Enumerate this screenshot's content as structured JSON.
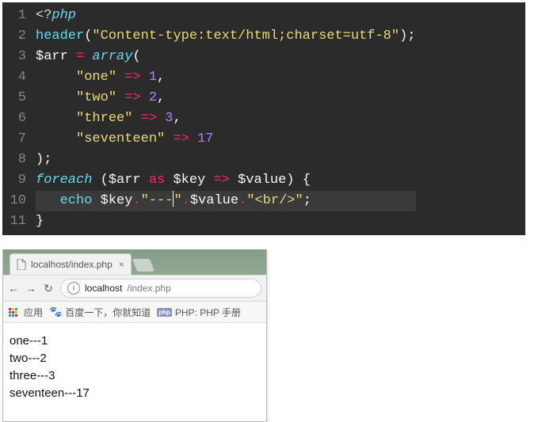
{
  "editor": {
    "lines": [
      {
        "n": 1,
        "tokens": [
          [
            "tag",
            "<?"
          ],
          [
            "kw",
            "php"
          ]
        ]
      },
      {
        "n": 2,
        "tokens": [
          [
            "fn",
            "header"
          ],
          [
            "punc",
            "("
          ],
          [
            "str",
            "\"Content-type:text/html;charset=utf-8\""
          ],
          [
            "punc",
            ")"
          ],
          [
            "punc",
            ";"
          ]
        ]
      },
      {
        "n": 3,
        "tokens": [
          [
            "var",
            "$arr "
          ],
          [
            "op",
            "="
          ],
          [
            "var",
            " "
          ],
          [
            "kw",
            "array"
          ],
          [
            "punc",
            "("
          ]
        ]
      },
      {
        "n": 4,
        "tokens": [
          [
            "var",
            "     "
          ],
          [
            "str",
            "\"one\""
          ],
          [
            "var",
            " "
          ],
          [
            "op",
            "=>"
          ],
          [
            "var",
            " "
          ],
          [
            "num",
            "1"
          ],
          [
            "punc",
            ","
          ]
        ]
      },
      {
        "n": 5,
        "tokens": [
          [
            "var",
            "     "
          ],
          [
            "str",
            "\"two\""
          ],
          [
            "var",
            " "
          ],
          [
            "op",
            "=>"
          ],
          [
            "var",
            " "
          ],
          [
            "num",
            "2"
          ],
          [
            "punc",
            ","
          ]
        ]
      },
      {
        "n": 6,
        "tokens": [
          [
            "var",
            "     "
          ],
          [
            "str",
            "\"three\""
          ],
          [
            "var",
            " "
          ],
          [
            "op",
            "=>"
          ],
          [
            "var",
            " "
          ],
          [
            "num",
            "3"
          ],
          [
            "punc",
            ","
          ]
        ]
      },
      {
        "n": 7,
        "tokens": [
          [
            "var",
            "     "
          ],
          [
            "str",
            "\"seventeen\""
          ],
          [
            "var",
            " "
          ],
          [
            "op",
            "=>"
          ],
          [
            "var",
            " "
          ],
          [
            "num",
            "17"
          ]
        ]
      },
      {
        "n": 8,
        "tokens": [
          [
            "punc",
            ")"
          ],
          [
            "punc",
            ";"
          ]
        ]
      },
      {
        "n": 9,
        "tokens": [
          [
            "kw",
            "foreach"
          ],
          [
            "var",
            " "
          ],
          [
            "punc",
            "("
          ],
          [
            "var",
            "$arr "
          ],
          [
            "op",
            "as"
          ],
          [
            "var",
            " $key "
          ],
          [
            "op",
            "=>"
          ],
          [
            "var",
            " $value"
          ],
          [
            "punc",
            ")"
          ],
          [
            "var",
            " "
          ],
          [
            "punc",
            "{"
          ]
        ]
      },
      {
        "n": 10,
        "hl": true,
        "tokens": [
          [
            "var",
            "   "
          ],
          [
            "fn",
            "echo"
          ],
          [
            "var",
            " $key"
          ],
          [
            "op",
            "."
          ],
          [
            "str",
            "\"---"
          ],
          [
            "cursor",
            ""
          ],
          [
            "str",
            "\""
          ],
          [
            "op",
            "."
          ],
          [
            "var",
            "$value"
          ],
          [
            "op",
            "."
          ],
          [
            "str",
            "\"<br/>\""
          ],
          [
            "punc",
            ";"
          ]
        ]
      },
      {
        "n": 11,
        "tokens": [
          [
            "punc",
            "}"
          ]
        ]
      }
    ]
  },
  "browser": {
    "tab_title": "localhost/index.php",
    "url_host": "localhost",
    "url_path": "/index.php",
    "bookmarks": {
      "apps": "应用",
      "baidu": "百度一下，你就知道",
      "php": "PHP: PHP 手册"
    },
    "output_lines": [
      "one---1",
      "two---2",
      "three---3",
      "seventeen---17"
    ]
  }
}
